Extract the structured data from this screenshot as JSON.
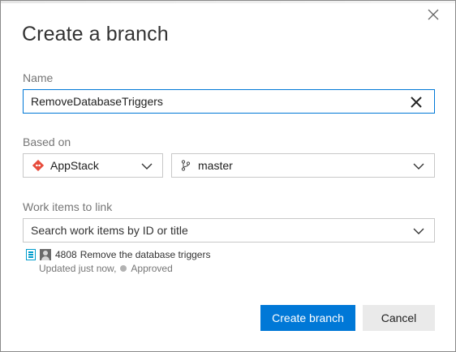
{
  "dialog": {
    "title": "Create a branch",
    "close_icon": "close-icon"
  },
  "name": {
    "label": "Name",
    "value": "RemoveDatabaseTriggers",
    "clear_icon": "clear-icon"
  },
  "based_on": {
    "label": "Based on",
    "repository": {
      "icon": "git-repo-icon",
      "value": "AppStack"
    },
    "branch": {
      "icon": "git-branch-icon",
      "value": "master"
    }
  },
  "work_items": {
    "label": "Work items to link",
    "search_placeholder": "Search work items by ID or title",
    "items": [
      {
        "type_icon": "task-icon",
        "id": "4808",
        "title": "Remove the database triggers",
        "updated": "Updated just now,",
        "state": "Approved"
      }
    ]
  },
  "buttons": {
    "create_label": "Create branch",
    "cancel_label": "Cancel"
  },
  "colors": {
    "accent": "#0078d7",
    "git_orange": "#e74c3c",
    "task_blue": "#009ccc",
    "state_grey": "#b2b2b2"
  }
}
